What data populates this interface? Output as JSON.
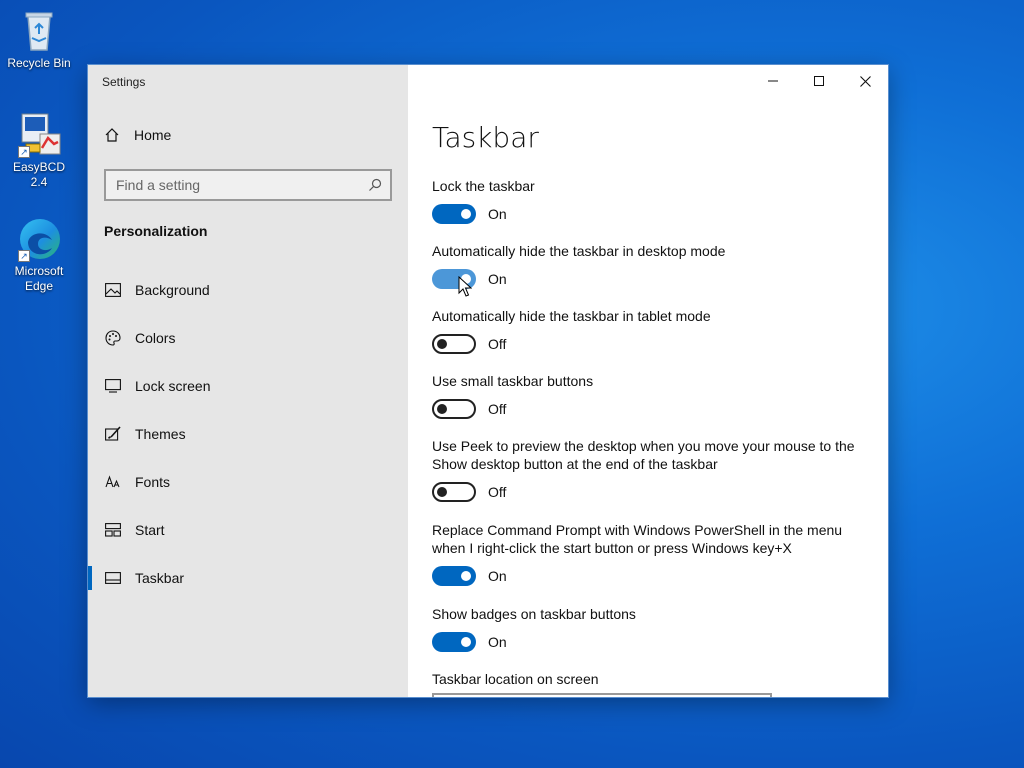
{
  "desktop": {
    "icons": [
      {
        "label": "Recycle Bin"
      },
      {
        "label": "EasyBCD 2.4"
      },
      {
        "label": "Microsoft Edge"
      }
    ]
  },
  "window": {
    "title": "Settings",
    "caption": {
      "minimize": "minimize-icon",
      "maximize": "maximize-icon",
      "close": "close-icon"
    }
  },
  "sidebar": {
    "home_label": "Home",
    "search_placeholder": "Find a setting",
    "section_title": "Personalization",
    "items": [
      {
        "label": "Background",
        "icon": "picture-icon"
      },
      {
        "label": "Colors",
        "icon": "palette-icon"
      },
      {
        "label": "Lock screen",
        "icon": "monitor-icon"
      },
      {
        "label": "Themes",
        "icon": "brush-icon"
      },
      {
        "label": "Fonts",
        "icon": "font-icon"
      },
      {
        "label": "Start",
        "icon": "start-grid-icon"
      },
      {
        "label": "Taskbar",
        "icon": "taskbar-icon",
        "active": true
      }
    ]
  },
  "content": {
    "title": "Taskbar",
    "settings": [
      {
        "label": "Lock the taskbar",
        "state": "On"
      },
      {
        "label": "Automatically hide the taskbar in desktop mode",
        "state": "On"
      },
      {
        "label": "Automatically hide the taskbar in tablet mode",
        "state": "Off"
      },
      {
        "label": "Use small taskbar buttons",
        "state": "Off"
      },
      {
        "label_line1": "Use Peek to preview the desktop when you move your mouse to the",
        "label_line2": "Show desktop button at the end of the taskbar",
        "state": "Off"
      },
      {
        "label_line1": "Replace Command Prompt with Windows PowerShell in the menu",
        "label_line2": "when I right-click the start button or press Windows key+X",
        "state": "On"
      },
      {
        "label": "Show badges on taskbar buttons",
        "state": "On"
      }
    ],
    "location_label": "Taskbar location on screen"
  },
  "colors": {
    "accent": "#0067c0",
    "sidebar_bg": "#e6e6e6",
    "desktop": "#0f6fd6"
  }
}
